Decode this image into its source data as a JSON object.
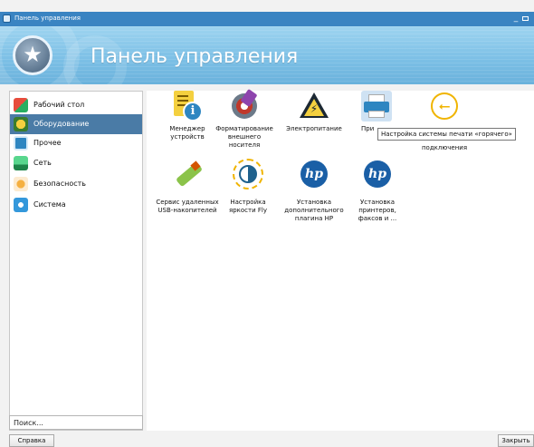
{
  "window": {
    "title": "Панель управления",
    "minimize_label": "_"
  },
  "banner": {
    "heading": "Панель управления",
    "badge_icon": "star-icon",
    "badge_glyph": "★"
  },
  "sidebar": {
    "items": [
      {
        "label": "Рабочий стол",
        "icon": "desktop-icon"
      },
      {
        "label": "Оборудование",
        "icon": "hardware-icon",
        "active": true
      },
      {
        "label": "Прочее",
        "icon": "other-icon"
      },
      {
        "label": "Сеть",
        "icon": "network-icon"
      },
      {
        "label": "Безопасность",
        "icon": "security-icon"
      },
      {
        "label": "Система",
        "icon": "system-icon"
      }
    ]
  },
  "search": {
    "placeholder": "Поиск..."
  },
  "applets": [
    {
      "label": "Менеджер устройств",
      "icon": "device-manager-icon"
    },
    {
      "label": "Форматирование внешнего носителя",
      "icon": "format-media-icon"
    },
    {
      "label": "Электропитание",
      "icon": "power-icon",
      "glyph": "⚡"
    },
    {
      "label": "При",
      "icon": "printer-icon"
    },
    {
      "label": "подключения",
      "icon": "usb-hotplug-icon",
      "glyph": "⭠"
    },
    {
      "label": "Сервис удаленных USB-накопителей",
      "icon": "usb-stick-icon"
    },
    {
      "label": "Настройка яркости Fly",
      "icon": "brightness-icon"
    },
    {
      "label": "Установка дополнительного плагина HP",
      "icon": "hp-icon",
      "glyph": "hp"
    },
    {
      "label": "Установка принтеров, факсов и ...",
      "icon": "hp-icon",
      "glyph": "hp"
    }
  ],
  "tooltip": {
    "text": "Настройка системы печати «горячего»"
  },
  "buttons": {
    "help": "Справка",
    "close": "Закрыть"
  },
  "colors": {
    "titlebar": "#3a84c2",
    "banner": "#7dc0e6",
    "sidebar_active": "#4a7ba6",
    "window_bg": "#f2f2f2"
  }
}
